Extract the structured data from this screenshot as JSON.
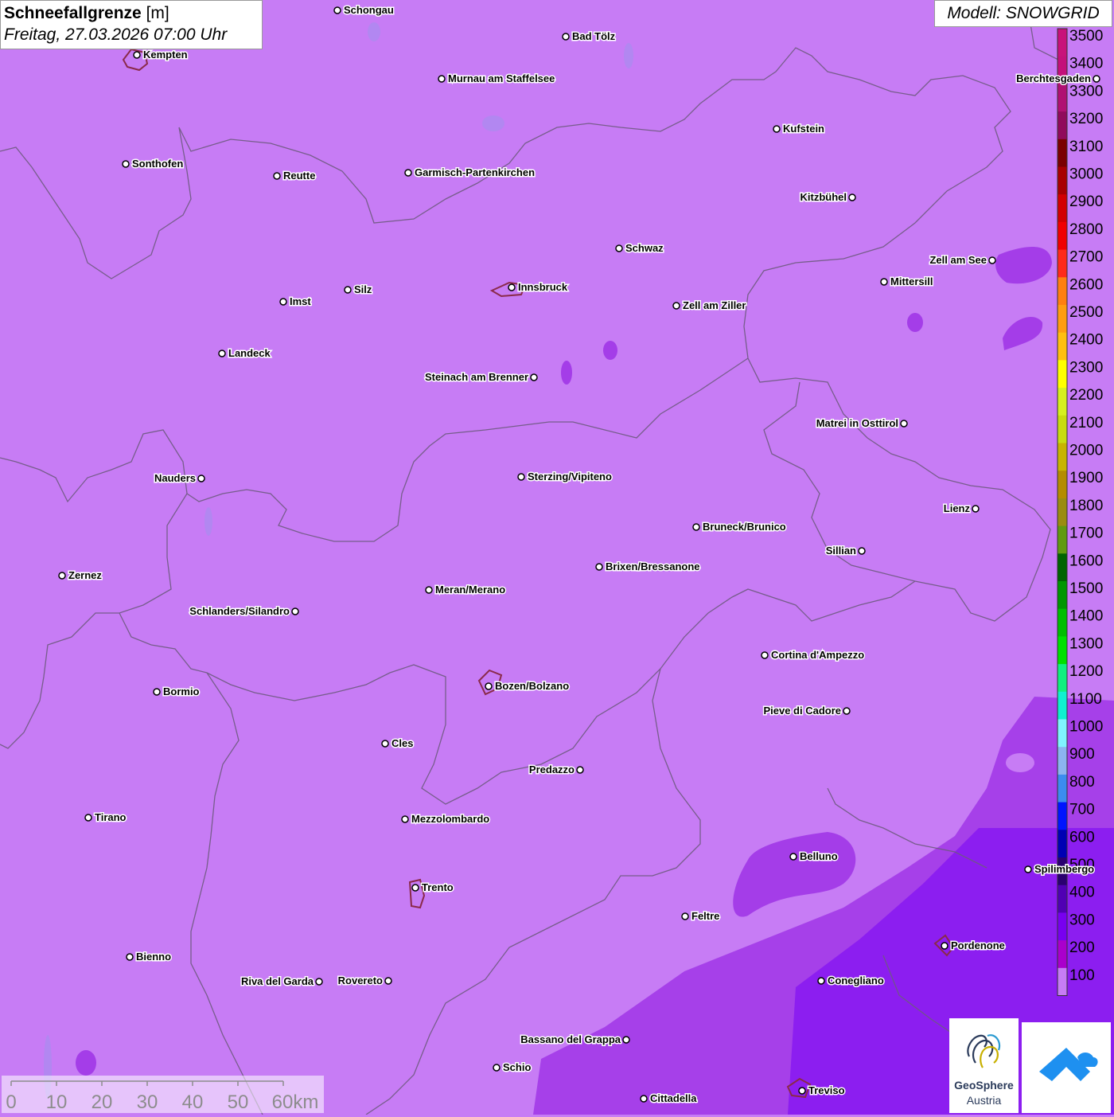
{
  "header": {
    "title_bold": "Schneefallgrenze",
    "title_unit": "[m]",
    "datetime": "Freitag, 27.03.2026 07:00 Uhr"
  },
  "model_label": "Modell: SNOWGRID",
  "legend": {
    "levels": [
      {
        "label": "3500",
        "color": "#c8127a"
      },
      {
        "label": "3400",
        "color": "#c4107a"
      },
      {
        "label": "3300",
        "color": "#b01072"
      },
      {
        "label": "3200",
        "color": "#900a5c"
      },
      {
        "label": "3100",
        "color": "#7a0000"
      },
      {
        "label": "3000",
        "color": "#a80000"
      },
      {
        "label": "2900",
        "color": "#d20000"
      },
      {
        "label": "2800",
        "color": "#f00000"
      },
      {
        "label": "2700",
        "color": "#ff2a1a"
      },
      {
        "label": "2600",
        "color": "#ff7f10"
      },
      {
        "label": "2500",
        "color": "#ff9d10"
      },
      {
        "label": "2400",
        "color": "#ffbf10"
      },
      {
        "label": "2300",
        "color": "#ffff00"
      },
      {
        "label": "2200",
        "color": "#d6f020"
      },
      {
        "label": "2100",
        "color": "#c8dc10"
      },
      {
        "label": "2000",
        "color": "#c8b400"
      },
      {
        "label": "1900",
        "color": "#b48c00"
      },
      {
        "label": "1800",
        "color": "#9a8c10"
      },
      {
        "label": "1700",
        "color": "#609a10"
      },
      {
        "label": "1600",
        "color": "#006400"
      },
      {
        "label": "1500",
        "color": "#009600"
      },
      {
        "label": "1400",
        "color": "#00be00"
      },
      {
        "label": "1300",
        "color": "#00e000"
      },
      {
        "label": "1200",
        "color": "#10f080"
      },
      {
        "label": "1100",
        "color": "#10f0d0"
      },
      {
        "label": "1000",
        "color": "#80f4ff"
      },
      {
        "label": "900",
        "color": "#8cb4f0"
      },
      {
        "label": "800",
        "color": "#3c8cf0"
      },
      {
        "label": "700",
        "color": "#0014ff"
      },
      {
        "label": "600",
        "color": "#0000b4"
      },
      {
        "label": "500",
        "color": "#2a0070"
      },
      {
        "label": "400",
        "color": "#5000b4"
      },
      {
        "label": "300",
        "color": "#7800f0"
      },
      {
        "label": "200",
        "color": "#aa00cc"
      },
      {
        "label": "100",
        "color": "#c77cf5"
      }
    ]
  },
  "cities": [
    {
      "name": "Schongau",
      "side": "right"
    },
    {
      "name": "Bad Tölz",
      "side": "right"
    },
    {
      "name": "Kempten",
      "side": "right"
    },
    {
      "name": "Murnau am Staffelsee",
      "side": "right"
    },
    {
      "name": "Berchtesgaden",
      "side": "left"
    },
    {
      "name": "Kufstein",
      "side": "right"
    },
    {
      "name": "Sonthofen",
      "side": "right"
    },
    {
      "name": "Reutte",
      "side": "right"
    },
    {
      "name": "Garmisch-Partenkirchen",
      "side": "right"
    },
    {
      "name": "Kitzbühel",
      "side": "left"
    },
    {
      "name": "Schwaz",
      "side": "right"
    },
    {
      "name": "Zell am See",
      "side": "left"
    },
    {
      "name": "Mittersill",
      "side": "right"
    },
    {
      "name": "Innsbruck",
      "side": "right"
    },
    {
      "name": "Silz",
      "side": "right"
    },
    {
      "name": "Imst",
      "side": "right"
    },
    {
      "name": "Zell am Ziller",
      "side": "right"
    },
    {
      "name": "Landeck",
      "side": "right"
    },
    {
      "name": "Steinach am Brenner",
      "side": "left"
    },
    {
      "name": "Matrei in Osttirol",
      "side": "left"
    },
    {
      "name": "Nauders",
      "side": "left"
    },
    {
      "name": "Sterzing/Vipiteno",
      "side": "right"
    },
    {
      "name": "Lienz",
      "side": "left"
    },
    {
      "name": "Bruneck/Brunico",
      "side": "right"
    },
    {
      "name": "Sillian",
      "side": "left"
    },
    {
      "name": "Brixen/Bressanone",
      "side": "right"
    },
    {
      "name": "Zernez",
      "side": "right"
    },
    {
      "name": "Meran/Merano",
      "side": "right"
    },
    {
      "name": "Schlanders/Silandro",
      "side": "left"
    },
    {
      "name": "Cortina d'Ampezzo",
      "side": "right"
    },
    {
      "name": "Bozen/Bolzano",
      "side": "right"
    },
    {
      "name": "Bormio",
      "side": "right"
    },
    {
      "name": "Pieve di Cadore",
      "side": "left"
    },
    {
      "name": "Cles",
      "side": "right"
    },
    {
      "name": "Predazzo",
      "side": "left"
    },
    {
      "name": "Tirano",
      "side": "right"
    },
    {
      "name": "Mezzolombardo",
      "side": "right"
    },
    {
      "name": "Belluno",
      "side": "right"
    },
    {
      "name": "Spilimbergo",
      "side": "right"
    },
    {
      "name": "Trento",
      "side": "right"
    },
    {
      "name": "Feltre",
      "side": "right"
    },
    {
      "name": "Pordenone",
      "side": "right"
    },
    {
      "name": "Bienno",
      "side": "right"
    },
    {
      "name": "Riva del Garda",
      "side": "left"
    },
    {
      "name": "Rovereto",
      "side": "left"
    },
    {
      "name": "Conegliano",
      "side": "right"
    },
    {
      "name": "Bassano del Grappa",
      "side": "left"
    },
    {
      "name": "Schio",
      "side": "right"
    },
    {
      "name": "Treviso",
      "side": "right"
    },
    {
      "name": "Cittadella",
      "side": "right"
    }
  ],
  "scale": {
    "labels": [
      "0",
      "10",
      "20",
      "30",
      "40",
      "50",
      "60km"
    ]
  },
  "logos": {
    "geosphere_name": "GeoSphere",
    "geosphere_sub": "Austria"
  }
}
